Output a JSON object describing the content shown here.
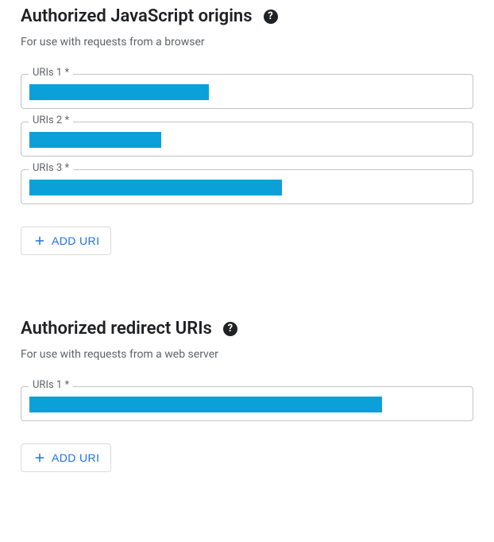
{
  "sections": [
    {
      "title": "Authorized JavaScript origins",
      "description": "For use with requests from a browser",
      "fields": [
        {
          "label": "URIs 1 *",
          "redactedWidth": 226
        },
        {
          "label": "URIs 2 *",
          "redactedWidth": 166
        },
        {
          "label": "URIs 3 *",
          "redactedWidth": 318
        }
      ],
      "addButtonLabel": "ADD URI"
    },
    {
      "title": "Authorized redirect URIs",
      "description": "For use with requests from a web server",
      "fields": [
        {
          "label": "URIs 1 *",
          "redactedWidth": 444
        }
      ],
      "addButtonLabel": "ADD URI"
    }
  ],
  "helpTooltip": "?"
}
